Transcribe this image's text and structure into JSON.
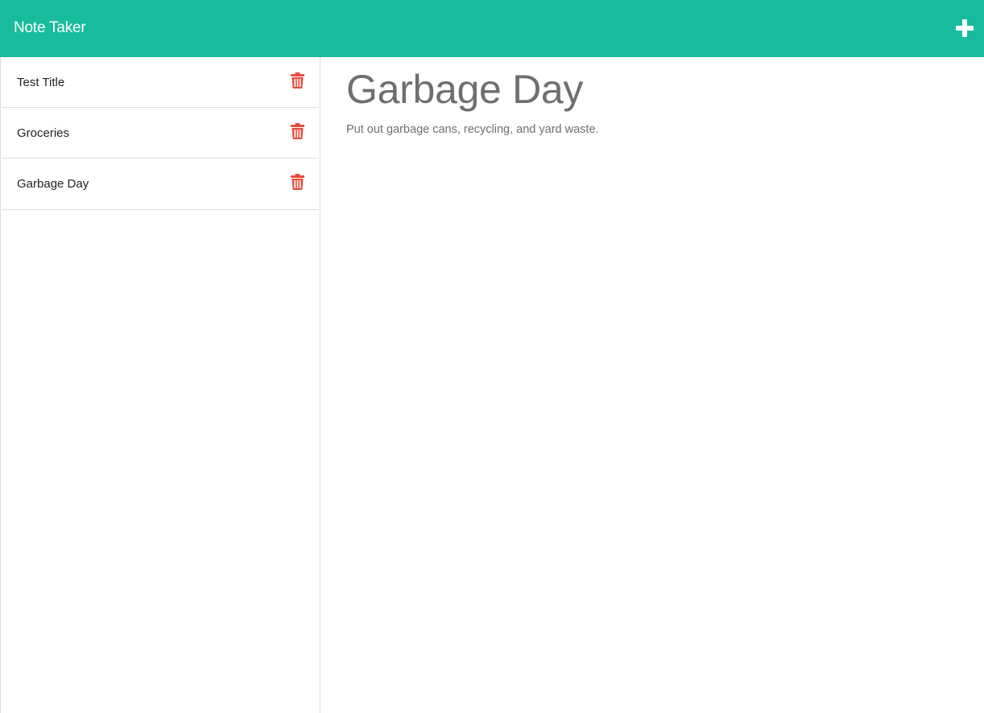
{
  "app": {
    "brand": "Note Taker",
    "new_note_icon": "plus-icon",
    "accent_color": "#18bc9c",
    "delete_color": "#e74c3c"
  },
  "sidebar": {
    "notes": [
      {
        "title": "Test Title",
        "delete_icon": "trash-icon"
      },
      {
        "title": "Groceries",
        "delete_icon": "trash-icon"
      },
      {
        "title": "Garbage Day",
        "delete_icon": "trash-icon"
      }
    ]
  },
  "main": {
    "title": "Garbage Day",
    "body": "Put out garbage cans, recycling, and yard waste."
  }
}
